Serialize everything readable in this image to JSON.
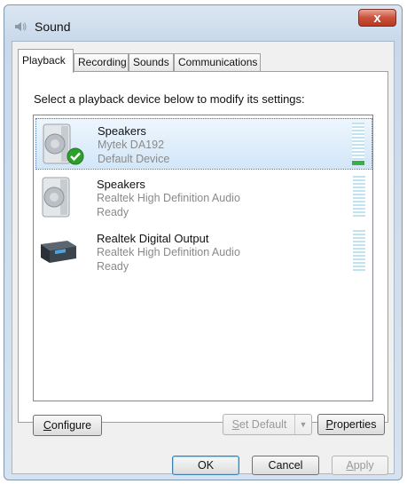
{
  "window": {
    "title": "Sound",
    "close_label": "x"
  },
  "tabs": [
    {
      "label": "Playback",
      "active": true
    },
    {
      "label": "Recording",
      "active": false
    },
    {
      "label": "Sounds",
      "active": false
    },
    {
      "label": "Communications",
      "active": false
    }
  ],
  "instruction": "Select a playback device below to modify its settings:",
  "devices": [
    {
      "name": "Speakers",
      "description": "Mytek DA192",
      "status": "Default Device",
      "icon": "speaker-icon",
      "selected": true,
      "is_default": true,
      "level": 0.1
    },
    {
      "name": "Speakers",
      "description": "Realtek High Definition Audio",
      "status": "Ready",
      "icon": "speaker-icon",
      "selected": false,
      "is_default": false,
      "level": 0
    },
    {
      "name": "Realtek Digital Output",
      "description": "Realtek High Definition Audio",
      "status": "Ready",
      "icon": "digital-output-icon",
      "selected": false,
      "is_default": false,
      "level": 0
    }
  ],
  "buttons": {
    "configure": {
      "prefix": "",
      "underline": "C",
      "rest": "onfigure"
    },
    "set_default": {
      "prefix": "",
      "underline": "S",
      "rest": "et Default",
      "arrow": "▼"
    },
    "properties": {
      "prefix": "",
      "underline": "P",
      "rest": "roperties"
    },
    "ok": "OK",
    "cancel": "Cancel",
    "apply": {
      "prefix": "",
      "underline": "A",
      "rest": "pply"
    }
  },
  "colors": {
    "meter_green": "#35b04a",
    "check_green": "#2e9e2e",
    "selection": "#d2e6f8"
  }
}
